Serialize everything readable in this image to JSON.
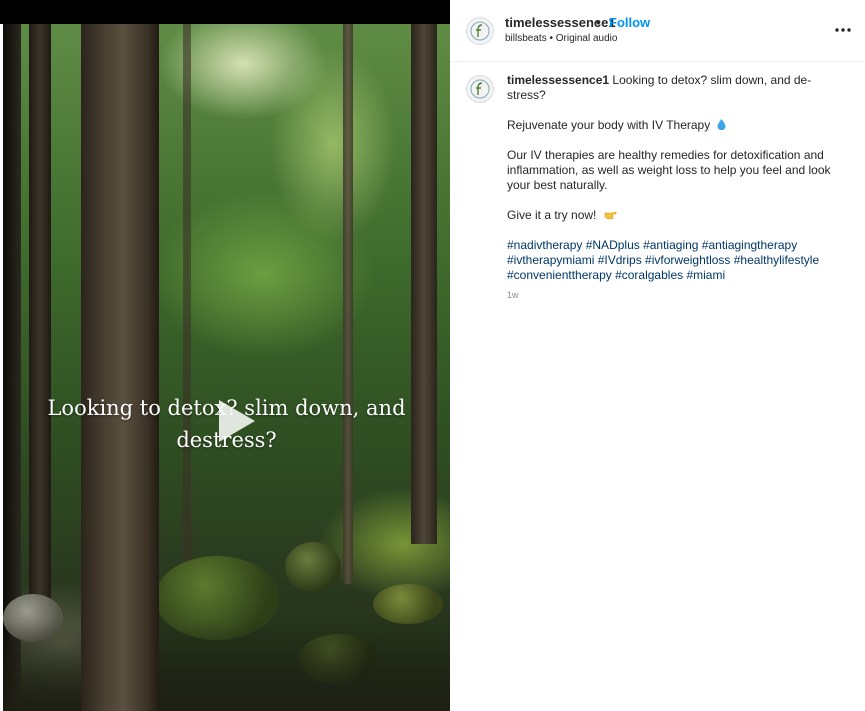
{
  "video": {
    "overlay_line1": "Looking to detox? slim down, and",
    "overlay_line2": "destress?",
    "play_icon": "play-icon"
  },
  "header": {
    "username": "timelessessence1",
    "separator": "•",
    "follow_label": "Follow",
    "audio_info": "billsbeats • Original audio",
    "more_icon": "more-horizontal-icon"
  },
  "caption": {
    "username": "timelessessence1",
    "line1": "Looking to detox? slim down, and de-stress?",
    "line2": "Rejuvenate your body with IV Therapy",
    "line3": "Our IV therapies are healthy remedies for detoxification and inflammation, as well as weight loss to help you feel and look your best naturally.",
    "line4": "Give it a try now!",
    "hashtags": "#nadivtherapy #NADplus #antiaging #antiagingtherapy #ivtherapymiami #IVdrips #ivforweightloss #healthylifestyle #convenienttherapy #coralgables #miami",
    "timestamp": "1w"
  },
  "colors": {
    "follow": "#0095f6",
    "hashtag": "#00376b",
    "text": "#262626",
    "muted": "#8e8e8e"
  }
}
